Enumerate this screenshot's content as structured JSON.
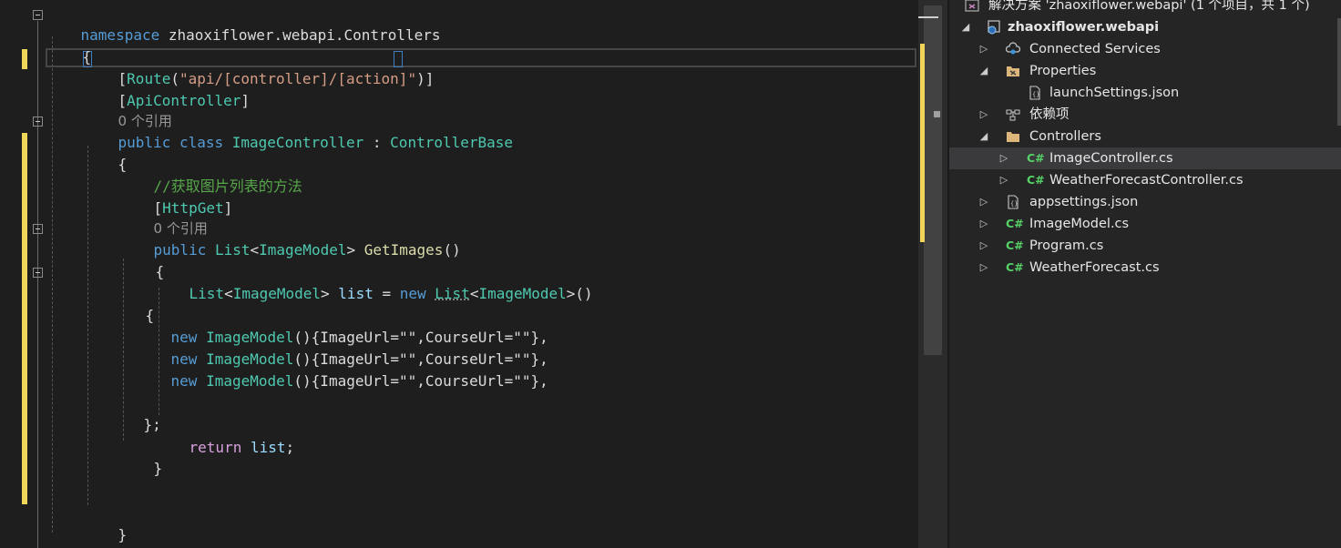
{
  "editor": {
    "lines": {
      "l1_ns_kw": "namespace",
      "l1_ns_name": " zhaoxiflower.webapi.Controllers",
      "l2": "{",
      "l3_route": "Route",
      "l3_route_str": "\"api/[controller]/[action]\"",
      "l4_api": "ApiController",
      "l5_refs": "0 个引用",
      "l6_public": "public",
      "l6_class": " class ",
      "l6_name": "ImageController",
      "l6_colon": " : ",
      "l6_base": "ControllerBase",
      "l7": "{",
      "l8_comment": "//获取图片列表的方法",
      "l9_attr": "HttpGet",
      "l10_refs": "0 个引用",
      "l11_public": "public",
      "l11_list": "List",
      "l11_model": "ImageModel",
      "l11_method": "GetImages",
      "l12": "{",
      "l13_list": "List",
      "l13_model": "ImageModel",
      "l13_var": "list",
      "l13_new": "new",
      "l13_list2": "List",
      "l13_model2": "ImageModel",
      "l14": "{",
      "init_new": "new",
      "init_model": "ImageModel",
      "init_rest": "{ImageUrl=\"\",CourseUrl=\"\"},",
      "l19": "};",
      "l20_return": "return",
      "l20_var": "list",
      "l21": "}",
      "l24": "}",
      "l25": "}"
    }
  },
  "explorer": {
    "solution": "解决方案 'zhaoxiflower.webapi' (1 个项目，共 1 个)",
    "project": "zhaoxiflower.webapi",
    "items": {
      "connected": "Connected Services",
      "properties": "Properties",
      "launch": "launchSettings.json",
      "deps": "依赖项",
      "controllers": "Controllers",
      "imagecontroller": "ImageController.cs",
      "weathercontroller": "WeatherForecastController.cs",
      "appsettings": "appsettings.json",
      "imagemodel": "ImageModel.cs",
      "program": "Program.cs",
      "weatherforecast": "WeatherForecast.cs"
    },
    "cs_badge": "C#"
  }
}
